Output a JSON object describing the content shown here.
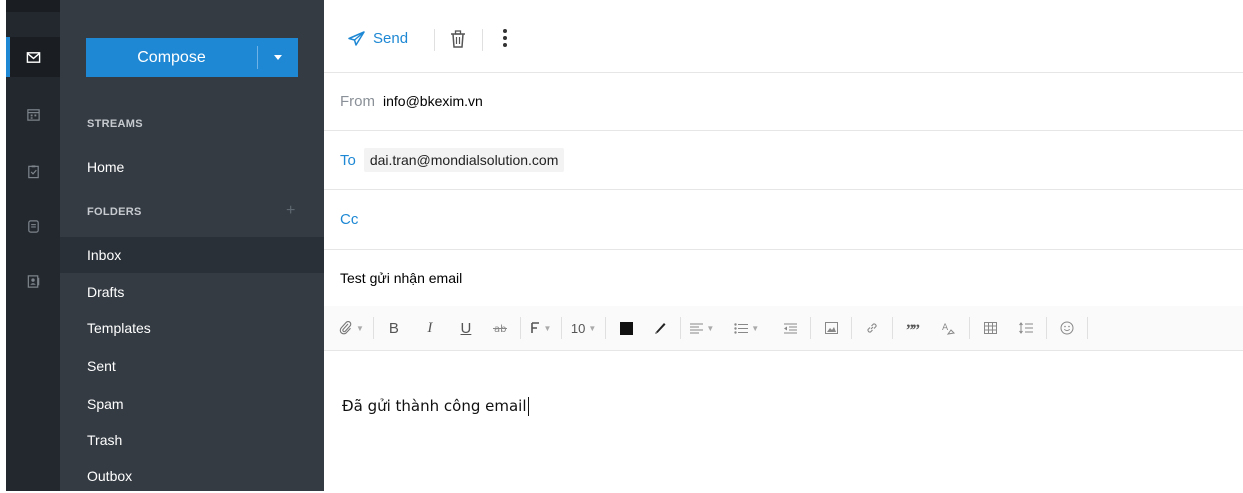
{
  "rail": {
    "items": [
      {
        "icon": "mail-icon",
        "active": true
      },
      {
        "icon": "calendar-icon",
        "active": false
      },
      {
        "icon": "tasks-icon",
        "active": false
      },
      {
        "icon": "notes-icon",
        "active": false
      },
      {
        "icon": "contacts-icon",
        "active": false
      }
    ]
  },
  "sidebar": {
    "compose_label": "Compose",
    "streams_heading": "STREAMS",
    "home_label": "Home",
    "folders_heading": "FOLDERS",
    "add_folder": "+",
    "folders": [
      "Inbox",
      "Drafts",
      "Templates",
      "Sent",
      "Spam",
      "Trash",
      "Outbox"
    ],
    "active_folder": "Inbox"
  },
  "toolbar": {
    "send_label": "Send"
  },
  "message": {
    "from_label": "From",
    "from_value": "info@bkexim.vn",
    "to_label": "To",
    "to_value": "dai.tran@mondialsolution.com",
    "cc_label": "Cc",
    "subject": "Test gửi nhận email",
    "body": "Đã gửi thành công email"
  },
  "format_bar": {
    "bold": "B",
    "italic": "I",
    "underline": "U",
    "font_size": "10"
  },
  "colors": {
    "accent": "#1e88d4",
    "rail_bg": "#23282e",
    "sidebar_bg": "#343b43"
  }
}
